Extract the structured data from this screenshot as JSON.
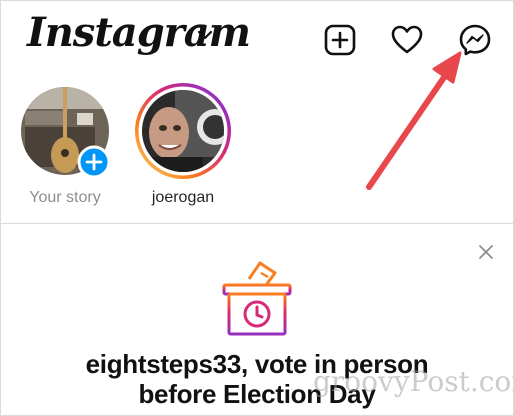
{
  "header": {
    "logo_text": "Instagram",
    "icons": [
      "chevron-down-icon",
      "new-post-icon",
      "heart-icon",
      "messenger-icon"
    ]
  },
  "stories": [
    {
      "label": "Your story",
      "label_color": "#8e8e8e",
      "badge": "+",
      "ring": false
    },
    {
      "label": "joerogan",
      "label_color": "#262626",
      "ring": true
    }
  ],
  "card": {
    "title_line1": "eightsteps33, vote in person",
    "title_line2": "before Election Day"
  },
  "watermark": "groovyPost.com",
  "colors": {
    "accent_blue": "#0095f6",
    "annotation_arrow": "#e8474b",
    "gradient": [
      "#feda75",
      "#fa7e1e",
      "#d62976",
      "#962fbf",
      "#4f5bd5"
    ]
  }
}
